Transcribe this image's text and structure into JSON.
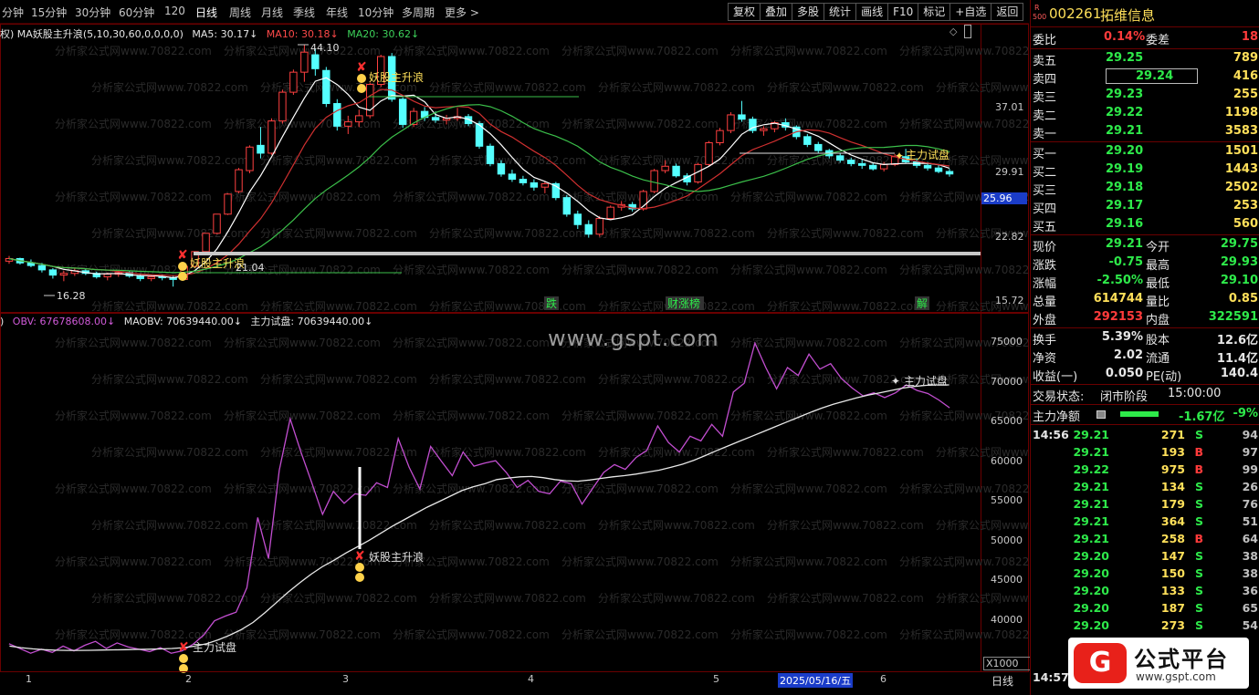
{
  "periods": [
    "分钟",
    "15分钟",
    "30分钟",
    "60分钟",
    "120",
    "日线",
    "周线",
    "月线",
    "季线",
    "年线",
    "10分钟",
    "多周期",
    "更多 >"
  ],
  "active_period": "日线",
  "tools": [
    "复权",
    "叠加",
    "多股",
    "统计",
    "画线",
    "F10",
    "标记",
    "+自选",
    "返回"
  ],
  "main_legend": {
    "prefix": "权)",
    "name": "MA妖股主升浪",
    "params": "(5,10,30,60,0,0,0,0)",
    "ma5": "MA5: 30.17↓",
    "ma10": "MA10: 30.18↓",
    "ma20": "MA20: 30.62↓"
  },
  "sub_legend": {
    "prefix": ")",
    "obv": "OBV: 67678608.00↓",
    "maobv": "MAOBV: 70639440.00↓",
    "zlsp": "主力试盘: 70639440.00↓"
  },
  "price_axis": [
    "37.01",
    "29.91",
    "22.82",
    "15.72"
  ],
  "price_marker": "25.96",
  "obv_axis": [
    "75000",
    "70000",
    "65000",
    "60000",
    "55000",
    "50000",
    "45000",
    "40000"
  ],
  "obv_unit": "X1000",
  "annotations": {
    "high": "44.10",
    "low": "16.28",
    "mid": "21.04",
    "signal1": "妖股主升浪",
    "signal2": "妖股主升浪",
    "signal3": "主力试盘",
    "signal4": "妖股主升浪",
    "signal5": "主力试盘",
    "events": [
      "跌",
      "财涨榜",
      "解"
    ]
  },
  "x_axis": [
    "1",
    "2",
    "3",
    "4",
    "5",
    "6"
  ],
  "date_marker": "2025/05/16/五",
  "bottom_period": "日线",
  "watermark": "www.gspt.com",
  "watermark_repeat": "分析家公式网www.70822.com",
  "chart_data": {
    "type": "line",
    "series": [
      {
        "name": "OBV",
        "values": [
          37800,
          37200,
          36600,
          37100,
          36700,
          37500,
          36900,
          37600,
          38100,
          37200,
          37900,
          37400,
          37100,
          36800,
          37300,
          36600,
          36900,
          37700,
          38900,
          40700,
          41300,
          41800,
          44900,
          53800,
          48600,
          59800,
          66300,
          62100,
          58200,
          54200,
          57100,
          55600,
          56800,
          56600,
          58200,
          57600,
          63800,
          60200,
          57400,
          62800,
          60900,
          59100,
          62100,
          60300,
          60700,
          61000,
          59500,
          57600,
          58500,
          57100,
          56800,
          58400,
          58100,
          55500,
          57500,
          59500,
          60500,
          59900,
          61400,
          62300,
          65400,
          63300,
          62100,
          64100,
          63500,
          65600,
          64100,
          69700,
          70800,
          75900,
          72800,
          70100,
          72800,
          71800,
          74500,
          72600,
          73300,
          71400,
          70200,
          69200,
          69600,
          69000,
          69600,
          70600,
          69900,
          69500,
          68700,
          67700
        ]
      },
      {
        "name": "MAOBV",
        "values": [
          37500,
          37300,
          37150,
          37050,
          36980,
          36950,
          36950,
          36970,
          37000,
          37020,
          37050,
          37080,
          37100,
          37140,
          37200,
          37300,
          37500,
          37800,
          38300,
          38900,
          39600,
          40500,
          41700,
          43000,
          44300,
          45500,
          46600,
          47600,
          48400,
          49300,
          50100,
          50900,
          51800,
          52700,
          53500,
          54300,
          55100,
          55800,
          56500,
          57200,
          57700,
          58100,
          58600,
          58800,
          58950,
          59000,
          58850,
          58600,
          58450,
          58400,
          58550,
          58750,
          58950,
          59100,
          59300,
          59550,
          59800,
          60150,
          60550,
          61050,
          61650,
          62300,
          62900,
          63500,
          64100,
          64700,
          65300,
          65900,
          66500,
          67100,
          67650,
          68150,
          68550,
          68950,
          69300,
          69600,
          69900,
          70200,
          70400,
          70550,
          70600,
          70600
        ]
      }
    ],
    "ylim": [
      35000,
      78000
    ],
    "candles_ylim": [
      14,
      45
    ],
    "candles": [
      [
        19.2,
        19.8,
        18.9,
        19.5
      ],
      [
        19.5,
        19.6,
        18.8,
        19.0
      ],
      [
        19.0,
        19.4,
        18.5,
        18.7
      ],
      [
        18.7,
        19.0,
        17.9,
        18.2
      ],
      [
        18.2,
        18.4,
        17.2,
        17.6
      ],
      [
        17.6,
        18.1,
        16.9,
        17.8
      ],
      [
        17.8,
        18.4,
        17.5,
        18.1
      ],
      [
        18.1,
        18.3,
        17.6,
        17.8
      ],
      [
        17.8,
        18.0,
        17.2,
        17.4
      ],
      [
        17.4,
        17.9,
        17.0,
        17.7
      ],
      [
        17.7,
        18.2,
        17.4,
        17.9
      ],
      [
        17.9,
        18.1,
        17.3,
        17.5
      ],
      [
        17.5,
        17.8,
        16.9,
        17.2
      ],
      [
        17.2,
        17.6,
        16.9,
        17.4
      ],
      [
        17.4,
        17.7,
        17.0,
        17.3
      ],
      [
        17.3,
        17.6,
        16.28,
        17.1
      ],
      [
        17.1,
        18.7,
        17.0,
        18.6
      ],
      [
        18.6,
        20.3,
        18.5,
        20.3
      ],
      [
        20.3,
        22.4,
        20.2,
        22.4
      ],
      [
        22.4,
        24.6,
        22.3,
        24.6
      ],
      [
        24.6,
        27.0,
        24.5,
        26.9
      ],
      [
        27.2,
        29.9,
        27.0,
        29.7
      ],
      [
        29.6,
        32.5,
        29.3,
        32.3
      ],
      [
        32.5,
        34.6,
        31.0,
        31.6
      ],
      [
        31.6,
        35.6,
        31.4,
        35.3
      ],
      [
        35.3,
        38.9,
        35.0,
        38.6
      ],
      [
        38.6,
        41.2,
        38.3,
        40.9
      ],
      [
        40.9,
        44.1,
        39.8,
        43.2
      ],
      [
        42.9,
        43.6,
        40.5,
        41.3
      ],
      [
        41.1,
        41.5,
        36.9,
        37.3
      ],
      [
        37.3,
        37.8,
        34.2,
        34.7
      ],
      [
        34.7,
        35.9,
        33.8,
        35.2
      ],
      [
        35.2,
        36.6,
        34.6,
        35.9
      ],
      [
        35.9,
        39.7,
        35.6,
        39.5
      ],
      [
        39.5,
        42.9,
        39.2,
        42.7
      ],
      [
        42.7,
        43.1,
        37.5,
        37.8
      ],
      [
        37.8,
        38.0,
        34.5,
        34.9
      ],
      [
        34.9,
        36.8,
        34.6,
        36.4
      ],
      [
        36.4,
        36.9,
        35.3,
        35.7
      ],
      [
        35.7,
        36.4,
        35.1,
        35.4
      ],
      [
        35.4,
        36.0,
        34.9,
        35.6
      ],
      [
        35.6,
        36.8,
        35.3,
        35.8
      ],
      [
        35.8,
        36.1,
        34.7,
        35.0
      ],
      [
        35.0,
        35.3,
        32.1,
        32.4
      ],
      [
        32.4,
        32.7,
        30.1,
        30.4
      ],
      [
        30.4,
        30.8,
        28.9,
        29.2
      ],
      [
        29.2,
        29.7,
        28.3,
        28.6
      ],
      [
        28.6,
        29.0,
        27.9,
        28.2
      ],
      [
        28.2,
        28.6,
        27.3,
        27.7
      ],
      [
        27.7,
        28.4,
        27.0,
        28.1
      ],
      [
        28.1,
        28.3,
        26.2,
        26.5
      ],
      [
        26.5,
        26.8,
        24.3,
        24.6
      ],
      [
        24.6,
        25.0,
        22.9,
        23.4
      ],
      [
        23.4,
        23.9,
        21.9,
        22.3
      ],
      [
        22.3,
        24.4,
        22.0,
        24.1
      ],
      [
        24.1,
        25.6,
        23.9,
        25.4
      ],
      [
        25.4,
        26.1,
        25.0,
        25.7
      ],
      [
        25.7,
        26.0,
        24.9,
        25.2
      ],
      [
        25.2,
        27.4,
        25.0,
        27.2
      ],
      [
        27.2,
        29.8,
        27.0,
        29.6
      ],
      [
        29.6,
        30.8,
        29.3,
        30.1
      ],
      [
        30.1,
        30.4,
        28.8,
        29.0
      ],
      [
        29.0,
        29.3,
        27.9,
        28.3
      ],
      [
        28.3,
        30.5,
        28.1,
        30.3
      ],
      [
        30.3,
        33.0,
        30.1,
        32.8
      ],
      [
        32.8,
        34.5,
        32.5,
        34.2
      ],
      [
        34.2,
        36.3,
        33.9,
        36.0
      ],
      [
        36.0,
        37.6,
        35.2,
        35.5
      ],
      [
        35.5,
        35.8,
        33.9,
        34.2
      ],
      [
        34.2,
        34.7,
        33.6,
        34.4
      ],
      [
        34.4,
        35.3,
        34.0,
        35.1
      ],
      [
        35.1,
        35.6,
        34.2,
        34.6
      ],
      [
        34.6,
        34.8,
        33.2,
        33.5
      ],
      [
        33.5,
        33.8,
        32.3,
        32.6
      ],
      [
        32.6,
        32.9,
        31.6,
        31.9
      ],
      [
        31.9,
        32.1,
        31.0,
        31.3
      ],
      [
        31.3,
        31.6,
        30.5,
        30.8
      ],
      [
        30.8,
        31.1,
        30.1,
        30.4
      ],
      [
        30.4,
        30.9,
        29.8,
        30.2
      ],
      [
        30.2,
        30.5,
        29.6,
        29.8
      ],
      [
        29.8,
        30.6,
        29.5,
        30.3
      ],
      [
        30.3,
        31.5,
        30.1,
        31.2
      ],
      [
        31.2,
        32.1,
        30.4,
        30.6
      ],
      [
        30.6,
        31.0,
        29.9,
        30.2
      ],
      [
        30.2,
        30.6,
        29.6,
        29.9
      ],
      [
        29.9,
        30.2,
        29.3,
        29.5
      ],
      [
        29.5,
        29.8,
        28.9,
        29.21
      ]
    ]
  },
  "quote": {
    "badge_r": "R",
    "badge_n": "500",
    "code": "002261",
    "name": "拓维信息",
    "webi_label": "委比",
    "webi": "0.14%",
    "weicha_label": "委差",
    "weicha": "18",
    "asks": [
      {
        "label": "卖五",
        "price": "29.25",
        "vol": "789"
      },
      {
        "label": "卖四",
        "price": "29.24",
        "vol": "416"
      },
      {
        "label": "卖三",
        "price": "29.23",
        "vol": "255"
      },
      {
        "label": "卖二",
        "price": "29.22",
        "vol": "1198"
      },
      {
        "label": "卖一",
        "price": "29.21",
        "vol": "3583"
      }
    ],
    "bids": [
      {
        "label": "买一",
        "price": "29.20",
        "vol": "1501"
      },
      {
        "label": "买二",
        "price": "29.19",
        "vol": "1443"
      },
      {
        "label": "买三",
        "price": "29.18",
        "vol": "2502"
      },
      {
        "label": "买四",
        "price": "29.17",
        "vol": "253"
      },
      {
        "label": "买五",
        "price": "29.16",
        "vol": "560"
      }
    ],
    "stats": [
      {
        "l1": "现价",
        "v1": "29.21",
        "c1": "green",
        "l2": "今开",
        "v2": "29.75",
        "c2": "green"
      },
      {
        "l1": "涨跌",
        "v1": "-0.75",
        "c1": "green",
        "l2": "最高",
        "v2": "29.93",
        "c2": "green"
      },
      {
        "l1": "涨幅",
        "v1": "-2.50%",
        "c1": "green",
        "l2": "最低",
        "v2": "29.10",
        "c2": "green"
      },
      {
        "l1": "总量",
        "v1": "614744",
        "c1": "yellow",
        "l2": "量比",
        "v2": "0.85",
        "c2": "yellow"
      },
      {
        "l1": "外盘",
        "v1": "292153",
        "c1": "red",
        "l2": "内盘",
        "v2": "322591",
        "c2": "green"
      }
    ],
    "stats2": [
      {
        "l1": "换手",
        "v1": "5.39%",
        "l2": "股本",
        "v2": "12.6亿"
      },
      {
        "l1": "净资",
        "v1": "2.02",
        "l2": "流通",
        "v2": "11.4亿"
      },
      {
        "l1": "收益(一)",
        "v1": "0.050",
        "l2": "PE(动)",
        "v2": "140.4"
      }
    ],
    "trade_status_label": "交易状态:",
    "trade_status": "闭市阶段",
    "trade_time": "15:00:00",
    "net_label": "主力净额",
    "net_value": "-1.67亿",
    "net_pct": "-9%",
    "ticks_time": "14:56",
    "ticks": [
      {
        "p": "29.21",
        "v": "271",
        "s": "S",
        "n": "94"
      },
      {
        "p": "29.21",
        "v": "193",
        "s": "B",
        "n": "97"
      },
      {
        "p": "29.22",
        "v": "975",
        "s": "B",
        "n": "99"
      },
      {
        "p": "29.21",
        "v": "134",
        "s": "S",
        "n": "26"
      },
      {
        "p": "29.21",
        "v": "179",
        "s": "S",
        "n": "76"
      },
      {
        "p": "29.21",
        "v": "364",
        "s": "S",
        "n": "51"
      },
      {
        "p": "29.21",
        "v": "258",
        "s": "B",
        "n": "64"
      },
      {
        "p": "29.20",
        "v": "147",
        "s": "S",
        "n": "38"
      },
      {
        "p": "29.20",
        "v": "150",
        "s": "S",
        "n": "38"
      },
      {
        "p": "29.20",
        "v": "133",
        "s": "S",
        "n": "36"
      },
      {
        "p": "29.20",
        "v": "187",
        "s": "S",
        "n": "65"
      },
      {
        "p": "29.20",
        "v": "273",
        "s": "S",
        "n": "54"
      }
    ],
    "last_time": "14:57",
    "logo_mark": "G",
    "logo_title": "公式平台",
    "logo_url": "www.gspt.com"
  }
}
